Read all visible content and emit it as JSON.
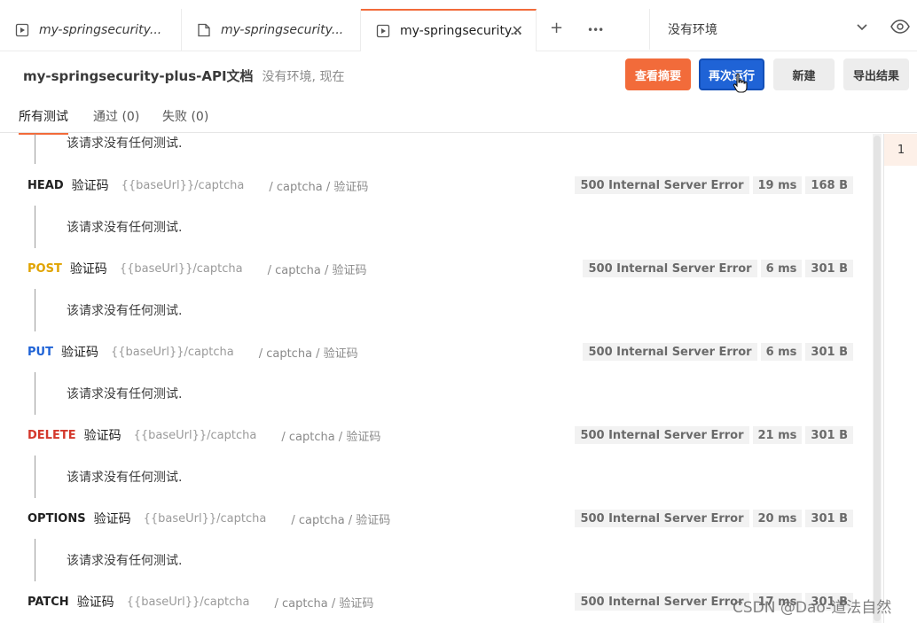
{
  "tabs": [
    {
      "label": "my-springsecurity...",
      "icon": "request-tab-icon",
      "active": false
    },
    {
      "label": "my-springsecurity...",
      "icon": "document-tab-icon",
      "active": false
    },
    {
      "label": "my-springsecurity...",
      "icon": "runner-tab-icon",
      "active": true
    }
  ],
  "tab_actions": {
    "close": "✕",
    "new": "+",
    "more": "•••"
  },
  "environment": {
    "label": "没有环境"
  },
  "header": {
    "title": "my-springsecurity-plus-API文档",
    "meta": "没有环境, 现在"
  },
  "buttons": {
    "summary": "查看摘要",
    "rerun": "再次运行",
    "new": "新建",
    "export": "导出结果"
  },
  "filters": [
    {
      "label": "所有测试",
      "active": true
    },
    {
      "label": "通过 (0)",
      "active": false
    },
    {
      "label": "失败 (0)",
      "active": false
    }
  ],
  "no_tests_text": "该请求没有任何测试.",
  "requests": [
    {
      "method": "HEAD",
      "method_color": "#212121",
      "name": "验证码",
      "url": "{{baseUrl}}/captcha",
      "path": "/ captcha / 验证码",
      "status": "500 Internal Server Error",
      "time": "19 ms",
      "size": "168 B"
    },
    {
      "method": "POST",
      "method_color": "#e0a300",
      "name": "验证码",
      "url": "{{baseUrl}}/captcha",
      "path": "/ captcha / 验证码",
      "status": "500 Internal Server Error",
      "time": "6 ms",
      "size": "301 B"
    },
    {
      "method": "PUT",
      "method_color": "#1f63d6",
      "name": "验证码",
      "url": "{{baseUrl}}/captcha",
      "path": "/ captcha / 验证码",
      "status": "500 Internal Server Error",
      "time": "6 ms",
      "size": "301 B"
    },
    {
      "method": "DELETE",
      "method_color": "#d4382c",
      "name": "验证码",
      "url": "{{baseUrl}}/captcha",
      "path": "/ captcha / 验证码",
      "status": "500 Internal Server Error",
      "time": "21 ms",
      "size": "301 B"
    },
    {
      "method": "OPTIONS",
      "method_color": "#212121",
      "name": "验证码",
      "url": "{{baseUrl}}/captcha",
      "path": "/ captcha / 验证码",
      "status": "500 Internal Server Error",
      "time": "20 ms",
      "size": "301 B"
    },
    {
      "method": "PATCH",
      "method_color": "#212121",
      "name": "验证码",
      "url": "{{baseUrl}}/captcha",
      "path": "/ captcha / 验证码",
      "status": "500 Internal Server Error",
      "time": "17 ms",
      "size": "301 B"
    }
  ],
  "iterations": [
    "1"
  ],
  "watermark": "CSDN @Dao-道法自然",
  "colors": {
    "accent_orange": "#f26b3a",
    "primary_blue": "#1f63d6",
    "badge_bg": "#f2f2f2"
  }
}
